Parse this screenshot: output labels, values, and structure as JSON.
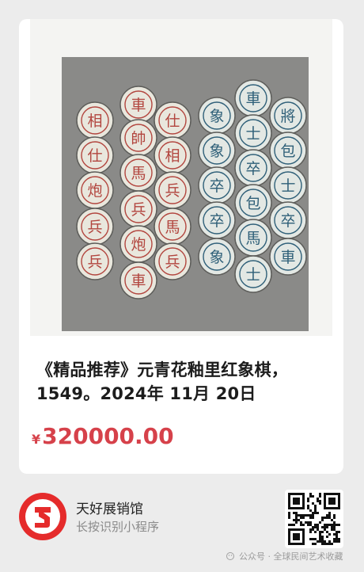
{
  "product": {
    "title": "《精品推荐》元青花釉里红象棋，1549。2024年 11月 20日",
    "currency": "¥",
    "price": "320000.00",
    "photo_icon": "chess-pieces-photo"
  },
  "mini_program": {
    "name": "天好展销馆",
    "hint": "长按识别小程序",
    "logo_icon": "shop-logo-icon",
    "qr_icon": "qr-code-icon"
  },
  "watermark": {
    "text": "公众号 · 全球民间艺术收藏"
  },
  "pieces": {
    "red": [
      "車",
      "相",
      "仕",
      "帥",
      "仕",
      "相",
      "馬",
      "炮",
      "兵",
      "兵",
      "兵",
      "馬",
      "炮",
      "兵",
      "兵",
      "車"
    ],
    "blue": [
      "車",
      "象",
      "將",
      "士",
      "象",
      "包",
      "卒",
      "卒",
      "士",
      "包",
      "卒",
      "卒",
      "馬",
      "象",
      "車",
      "士"
    ]
  },
  "colors": {
    "red_ink": "#b2453e",
    "blue_ink": "#2e5f78",
    "price": "#d6414a"
  }
}
